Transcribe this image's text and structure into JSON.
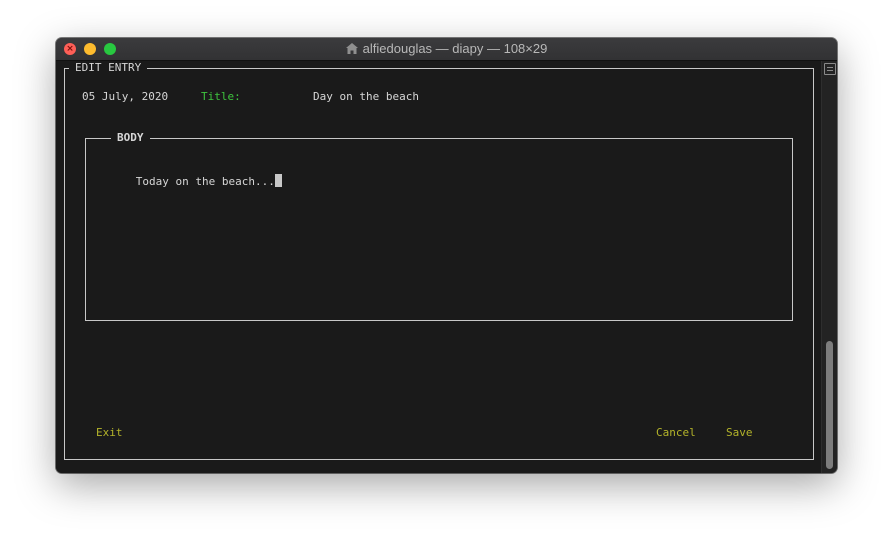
{
  "window": {
    "title": "alfiedouglas — diapy — 108×29"
  },
  "editor": {
    "frame_label": "EDIT ENTRY",
    "date": "05 July, 2020",
    "title_label": "Title:",
    "title_value": "Day on the beach",
    "body": {
      "frame_label": "BODY",
      "text": "Today on the beach..."
    },
    "footer": {
      "exit_label": "Exit",
      "cancel_label": "Cancel",
      "save_label": "Save"
    }
  },
  "colors": {
    "background": "#1a1a1a",
    "foreground": "#d6d6d6",
    "label_green": "#3ec43e",
    "action_olive": "#b3b32a"
  }
}
